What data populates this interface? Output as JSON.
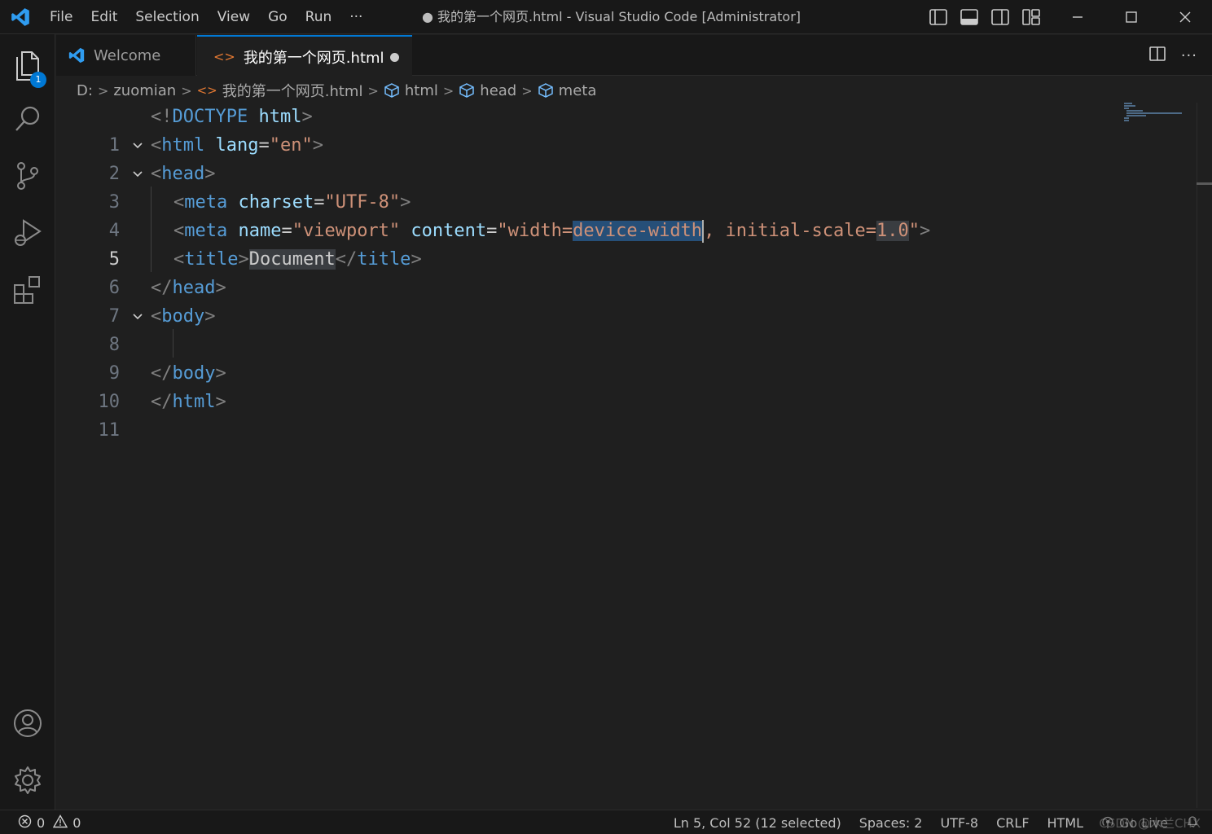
{
  "titlebar": {
    "menu": [
      "File",
      "Edit",
      "Selection",
      "View",
      "Go",
      "Run",
      "···"
    ],
    "window_title": "● 我的第一个网页.html - Visual Studio Code [Administrator]"
  },
  "activitybar": {
    "items": [
      "explorer-icon",
      "search-icon",
      "source-control-icon",
      "run-debug-icon",
      "extensions-icon"
    ],
    "explorer_badge": "1",
    "bottom": [
      "account-icon",
      "settings-gear-icon"
    ]
  },
  "tabs": [
    {
      "label": "Welcome",
      "active": false
    },
    {
      "label": "我的第一个网页.html",
      "active": true,
      "dirty": true
    }
  ],
  "breadcrumb": {
    "drive": "D:",
    "folder": "zuomian",
    "file": "我的第一个网页.html",
    "symbols": [
      "html",
      "head",
      "meta"
    ]
  },
  "editor": {
    "line_numbers": [
      "1",
      "2",
      "3",
      "4",
      "5",
      "6",
      "7",
      "8",
      "9",
      "10",
      "11"
    ],
    "active_line": 5,
    "lines": {
      "l1": {
        "open": "<!",
        "kw": "DOCTYPE",
        "attr": " html",
        "close": ">"
      },
      "l2": {
        "open": "<",
        "tag": "html",
        "attr": " lang",
        "eq": "=",
        "str": "\"en\"",
        "close": ">"
      },
      "l3": {
        "open": "<",
        "tag": "head",
        "close": ">"
      },
      "l4": {
        "open": "<",
        "tag": "meta",
        "attr": " charset",
        "eq": "=",
        "str": "\"UTF-8\"",
        "close": ">"
      },
      "l5": {
        "open": "<",
        "tag": "meta",
        "attr1": " name",
        "eq1": "=",
        "str1": "\"viewport\"",
        "attr2": " content",
        "eq2": "=",
        "str2a": "\"width=",
        "str2sel": "device-width",
        "str2b": ", initial-scale=",
        "str2hl": "1.0",
        "str2c": "\"",
        "close": ">"
      },
      "l6": {
        "open": "<",
        "tag": "title",
        "mid": ">",
        "text": "Document",
        "open2": "</",
        "tag2": "title",
        "close": ">"
      },
      "l7": {
        "open": "</",
        "tag": "head",
        "close": ">"
      },
      "l8": {
        "open": "<",
        "tag": "body",
        "close": ">"
      },
      "l10": {
        "open": "</",
        "tag": "body",
        "close": ">"
      },
      "l11": {
        "open": "</",
        "tag": "html",
        "close": ">"
      }
    }
  },
  "statusbar": {
    "errors": "0",
    "warnings": "0",
    "position": "Ln 5, Col 52 (12 selected)",
    "spaces": "Spaces: 2",
    "encoding": "UTF-8",
    "eol": "CRLF",
    "language": "HTML",
    "golive": "Go Live"
  },
  "watermark": "CSDN @木兰CHX",
  "colors": {
    "accent": "#0078d4",
    "tag": "#569cd6",
    "attr": "#9cdcfe",
    "string": "#ce9178",
    "selection": "#264f78"
  }
}
